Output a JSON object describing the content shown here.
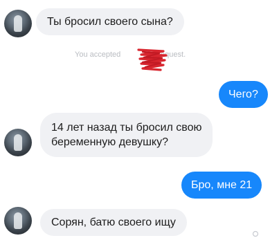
{
  "conversation": {
    "messages": [
      {
        "sender": "them",
        "text": "Ты бросил своего сына?"
      },
      {
        "sender": "me",
        "text": "Чего?"
      },
      {
        "sender": "them",
        "line1": "14 лет назад ты бросил свою",
        "line2": "беременную девушку?"
      },
      {
        "sender": "me",
        "text": "Бро, мне 21"
      },
      {
        "sender": "them",
        "text": "Сорян, батю своего ищу"
      }
    ],
    "system_notice": {
      "part1": "You accepted",
      "part2": "request."
    }
  },
  "colors": {
    "incoming_bubble": "#f0f1f4",
    "outgoing_bubble": "#1787fb",
    "scribble": "#d8262f"
  }
}
